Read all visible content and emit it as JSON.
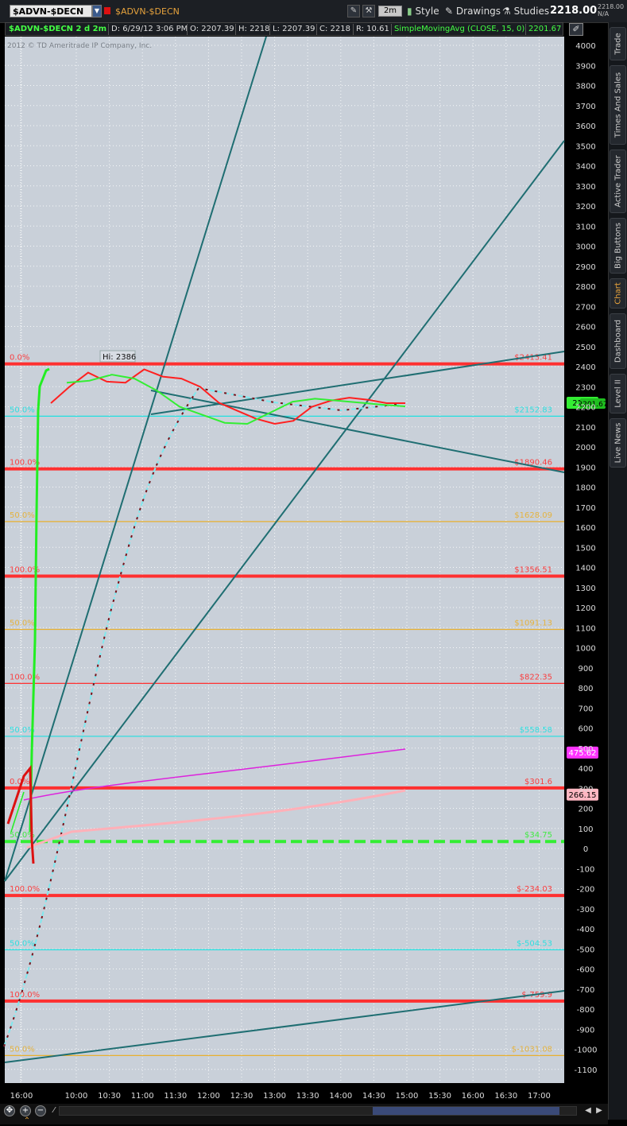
{
  "toolbar": {
    "symbol": "$ADVN-$DECN",
    "symbol_description": "$ADVN-$DECN",
    "aggregation": "2m",
    "style_label": "Style",
    "drawings_label": "Drawings",
    "studies_label": "Studies",
    "last_price": "2218.00",
    "tiny_price": "2218.00",
    "tiny_change": "N/A"
  },
  "infobar": {
    "title": "$ADVN-$DECN 2 d 2m",
    "date": "D: 6/29/12 3:06 PM",
    "open": "O: 2207.39",
    "high": "H: 2218",
    "low": "L: 2207.39",
    "close": "C: 2218",
    "range": "R: 10.61",
    "study": "SimpleMovingAvg (CLOSE, 15, 0)",
    "study_value": "2201.67"
  },
  "sidebar": {
    "tabs": [
      "Trade",
      "Times And Sales",
      "Active Trader",
      "Big Buttons",
      "Chart",
      "Dashboard",
      "Level II",
      "Live News"
    ],
    "active": "Chart"
  },
  "chart_data": {
    "type": "line",
    "copyright": "2012 © TD Ameritrade IP Company, Inc.",
    "high_label": "Hi: 2386",
    "ylim": [
      -1150,
      4050
    ],
    "y_ticks": [
      4000,
      3900,
      3800,
      3700,
      3600,
      3500,
      3400,
      3300,
      3200,
      3100,
      3000,
      2900,
      2800,
      2700,
      2600,
      2500,
      2400,
      2300,
      2200,
      2100,
      2000,
      1900,
      1800,
      1700,
      1600,
      1500,
      1400,
      1300,
      1200,
      1100,
      1000,
      900,
      800,
      700,
      600,
      500,
      400,
      300,
      200,
      100,
      0,
      -100,
      -200,
      -300,
      -400,
      -500,
      -600,
      -700,
      -800,
      -900,
      -1000,
      -1100
    ],
    "x_ticks": [
      "16:00",
      "10:00",
      "10:30",
      "11:00",
      "11:30",
      "12:00",
      "12:30",
      "13:00",
      "13:30",
      "14:00",
      "14:30",
      "15:00",
      "15:30",
      "16:00",
      "16:30",
      "17:00"
    ],
    "series": [
      {
        "values": [
          2218,
          2300,
          2370,
          2325,
          2320,
          2386,
          2350,
          2340,
          2300,
          2220,
          2180,
          2140,
          2115,
          2130,
          2200,
          2230,
          2245,
          2235,
          2218,
          2218
        ],
        "color": "#ff2020"
      },
      {
        "values": [
          2320,
          2330,
          2360,
          2340,
          2280,
          2200,
          2160,
          2120,
          2115,
          2170,
          2225,
          2240,
          2230,
          2220,
          2210,
          2201.67
        ],
        "color": "#33ee33"
      }
    ],
    "reference_lines": [
      {
        "value": 2413.41,
        "label": "$2413.41",
        "left_label": "0.0%",
        "color": "#ff3030",
        "thick": true
      },
      {
        "value": 2152.83,
        "label": "$2152.83",
        "left_label": "50.0%",
        "color": "#20e0e0",
        "thick": false
      },
      {
        "value": 1890.46,
        "label": "$1890.46",
        "left_label": "100.0%",
        "color": "#ff3030",
        "thick": true
      },
      {
        "value": 1628.09,
        "label": "$1628.09",
        "left_label": "50.0%",
        "color": "#e8b030",
        "thick": false
      },
      {
        "value": 1356.51,
        "label": "$1356.51",
        "left_label": "100.0%",
        "color": "#ff3030",
        "thick": true
      },
      {
        "value": 1091.13,
        "label": "$1091.13",
        "left_label": "50.0%",
        "color": "#e8b030",
        "thick": false
      },
      {
        "value": 822.35,
        "label": "$822.35",
        "left_label": "100.0%",
        "color": "#ff3030",
        "thick": false
      },
      {
        "value": 558.58,
        "label": "$558.58",
        "left_label": "50.0%",
        "color": "#20e0e0",
        "thick": false
      },
      {
        "value": 301.6,
        "label": "$301.6",
        "left_label": "0.0%",
        "color": "#ff3030",
        "thick": true
      },
      {
        "value": 34.75,
        "label": "$34.75",
        "left_label": "50.0%",
        "color": "#33ee33",
        "thick": true,
        "dashed": true
      },
      {
        "value": -234.03,
        "label": "$-234.03",
        "left_label": "100.0%",
        "color": "#ff3030",
        "thick": true
      },
      {
        "value": -504.53,
        "label": "$-504.53",
        "left_label": "50.0%",
        "color": "#20e0e0",
        "thick": false
      },
      {
        "value": -759.9,
        "label": "$-759.9",
        "left_label": "100.0%",
        "color": "#ff3030",
        "thick": true
      },
      {
        "value": -1031.08,
        "label": "$-1031.08",
        "left_label": "50.0%",
        "color": "#e8b030",
        "thick": false
      }
    ],
    "price_bubbles": [
      {
        "value": 2218,
        "label": "2218",
        "label2": "2201.67",
        "color": "#33ee33",
        "text_color": "#000"
      },
      {
        "value": 475.62,
        "label": "475.62",
        "color": "#ff33ff",
        "text_color": "#fff"
      },
      {
        "value": 266.15,
        "label": "266.15",
        "color": "#ffb6c1",
        "text_color": "#000"
      }
    ]
  }
}
